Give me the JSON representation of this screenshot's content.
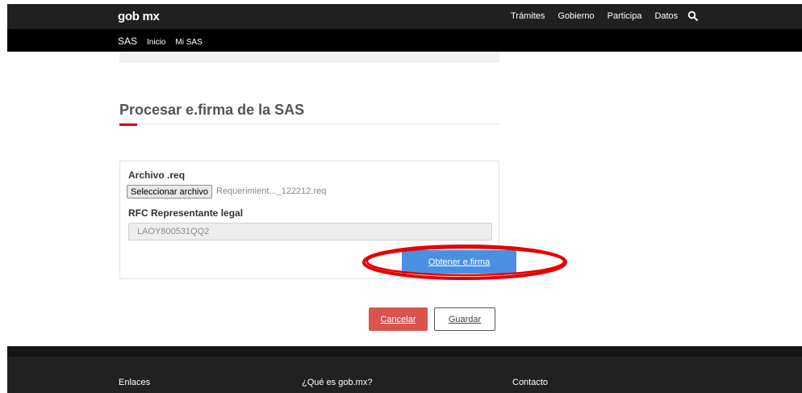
{
  "header": {
    "logo": "gob mx",
    "nav": [
      "Trámites",
      "Gobierno",
      "Participa",
      "Datos"
    ],
    "search_icon": "search-icon"
  },
  "subnav": {
    "section": "SAS",
    "items": [
      "Inicio",
      "Mi SAS"
    ]
  },
  "main": {
    "title": "Procesar e.firma de la SAS",
    "form": {
      "archivo_label": "Archivo .req",
      "file_button_label": "Seleccionar archivo",
      "file_name": "Requerimient..._122212.req",
      "rfc_label": "RFC Representante legal",
      "rfc_value": "LAOY800531QQ2",
      "efirma_button_label": "Obtener e.firma"
    },
    "actions": {
      "cancel_label": "Cancelar",
      "save_label": "Guardar"
    }
  },
  "footer": {
    "links": [
      "Enlaces",
      "¿Qué es gob.mx?",
      "Contacto"
    ]
  },
  "colors": {
    "header_bg": "#202020",
    "subnav_bg": "#000000",
    "accent_red": "#d0021b",
    "primary_button": "#4a90e2",
    "cancel_button": "#d9534f",
    "highlight_annotation": "#e60000",
    "footer_bg": "#212121"
  }
}
